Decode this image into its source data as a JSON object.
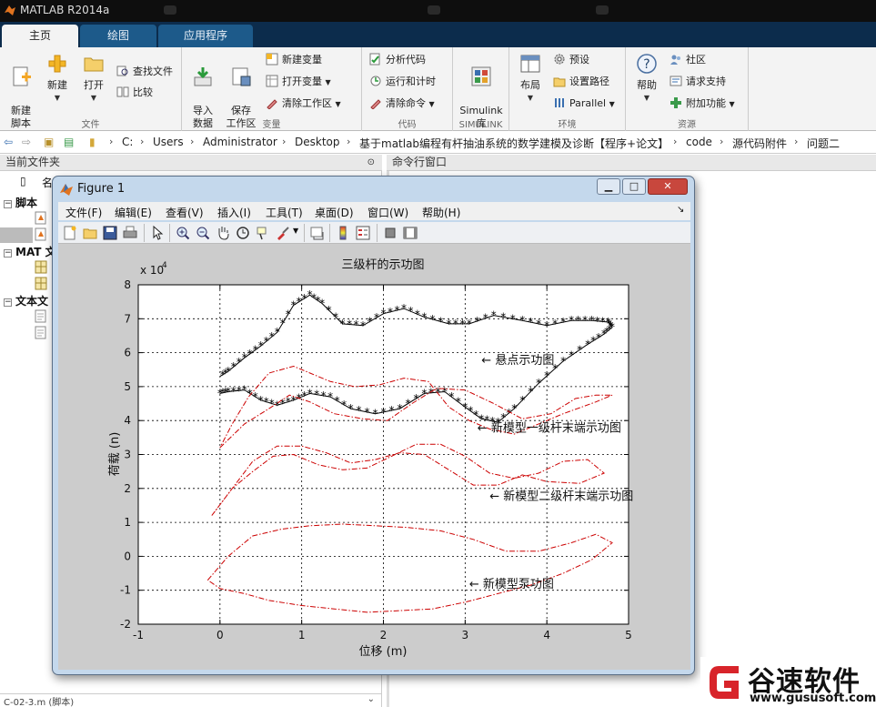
{
  "app": {
    "title": "MATLAB R2014a"
  },
  "tabs": [
    {
      "label": "主页",
      "active": true
    },
    {
      "label": "绘图",
      "active": false
    },
    {
      "label": "应用程序",
      "active": false
    }
  ],
  "ribbon": {
    "file": {
      "group": "文件",
      "new_script": "新建\n脚本",
      "new": "新建",
      "open": "打开",
      "find_files": "查找文件",
      "compare": "比较"
    },
    "variable": {
      "group": "变量",
      "import_data": "导入\n数据",
      "save_workspace": "保存\n工作区",
      "new_variable": "新建变量",
      "open_variable": "打开变量",
      "clear_workspace": "清除工作区"
    },
    "code": {
      "group": "代码",
      "analyze_code": "分析代码",
      "run_and_time": "运行和计时",
      "clear_commands": "清除命令"
    },
    "simulink": {
      "group": "SIMULINK",
      "library": "Simulink\n库"
    },
    "environment": {
      "group": "环境",
      "layout": "布局",
      "preferences": "预设",
      "set_path": "设置路径",
      "parallel": "Parallel"
    },
    "resources": {
      "group": "资源",
      "help": "帮助",
      "community": "社区",
      "request_support": "请求支持",
      "addons": "附加功能"
    }
  },
  "path": [
    "C:",
    "Users",
    "Administrator",
    "Desktop",
    "基于matlab编程有杆抽油系统的数学建模及诊断【程序+论文】",
    "code",
    "源代码附件",
    "问题二"
  ],
  "panels": {
    "current_folder": "当前文件夹",
    "command_window": "命令行窗口",
    "name_col": "名",
    "tree": [
      {
        "label": "脚本"
      },
      {
        "label": "MAT 文"
      },
      {
        "label": "文本文"
      }
    ],
    "status_file": "C-02-3.m (脚本)"
  },
  "figure": {
    "title": "Figure 1",
    "menu": [
      "文件(F)",
      "编辑(E)",
      "查看(V)",
      "插入(I)",
      "工具(T)",
      "桌面(D)",
      "窗口(W)",
      "帮助(H)"
    ]
  },
  "chart_data": {
    "type": "line",
    "title": "三级杆的示功图",
    "xlabel": "位移 (m)",
    "ylabel": "荷载 (n)",
    "y_scale_label": "x 10",
    "y_scale_exp": "4",
    "xlim": [
      -1,
      5
    ],
    "ylim": [
      -2,
      8
    ],
    "xticks": [
      -1,
      0,
      1,
      2,
      3,
      4,
      5
    ],
    "yticks": [
      -2,
      -1,
      0,
      1,
      2,
      3,
      4,
      5,
      6,
      7,
      8
    ],
    "grid": true,
    "series": [
      {
        "name": "悬点示功图",
        "color": "#000000",
        "style": "line-star",
        "points": [
          [
            0,
            4.8
          ],
          [
            0.1,
            4.85
          ],
          [
            0.3,
            4.9
          ],
          [
            0.5,
            4.6
          ],
          [
            0.7,
            4.45
          ],
          [
            0.9,
            4.6
          ],
          [
            1.1,
            4.8
          ],
          [
            1.35,
            4.7
          ],
          [
            1.6,
            4.35
          ],
          [
            1.9,
            4.2
          ],
          [
            2.2,
            4.35
          ],
          [
            2.5,
            4.8
          ],
          [
            2.75,
            4.85
          ],
          [
            3.0,
            4.4
          ],
          [
            3.2,
            4.05
          ],
          [
            3.4,
            3.95
          ],
          [
            3.6,
            4.35
          ],
          [
            3.9,
            5.1
          ],
          [
            4.2,
            5.75
          ],
          [
            4.5,
            6.25
          ],
          [
            4.7,
            6.55
          ],
          [
            4.8,
            6.75
          ],
          [
            4.75,
            6.9
          ],
          [
            4.55,
            6.95
          ],
          [
            4.3,
            6.95
          ],
          [
            4.0,
            6.8
          ],
          [
            3.7,
            6.95
          ],
          [
            3.35,
            7.1
          ],
          [
            3.05,
            6.85
          ],
          [
            2.8,
            6.85
          ],
          [
            2.5,
            7.05
          ],
          [
            2.25,
            7.3
          ],
          [
            2.0,
            7.15
          ],
          [
            1.75,
            6.8
          ],
          [
            1.5,
            6.85
          ],
          [
            1.25,
            7.45
          ],
          [
            1.1,
            7.7
          ],
          [
            0.9,
            7.4
          ],
          [
            0.7,
            6.6
          ],
          [
            0.5,
            6.2
          ],
          [
            0.3,
            5.85
          ],
          [
            0.1,
            5.45
          ],
          [
            0.0,
            5.3
          ]
        ]
      },
      {
        "name": "新模型一级杆末端示功图",
        "color": "#cc0000",
        "style": "dash-dot",
        "points": [
          [
            0,
            3.2
          ],
          [
            0.3,
            3.9
          ],
          [
            0.6,
            4.35
          ],
          [
            0.85,
            4.75
          ],
          [
            1.1,
            4.55
          ],
          [
            1.4,
            4.2
          ],
          [
            1.75,
            4.05
          ],
          [
            2.05,
            4.0
          ],
          [
            2.35,
            4.5
          ],
          [
            2.65,
            4.95
          ],
          [
            3.0,
            4.9
          ],
          [
            3.35,
            4.5
          ],
          [
            3.7,
            4.05
          ],
          [
            4.05,
            4.2
          ],
          [
            4.35,
            4.65
          ],
          [
            4.6,
            4.75
          ],
          [
            4.8,
            4.75
          ],
          [
            4.6,
            4.55
          ],
          [
            4.2,
            4.2
          ],
          [
            3.9,
            3.9
          ],
          [
            3.6,
            3.6
          ],
          [
            3.3,
            3.75
          ],
          [
            3.05,
            4.0
          ],
          [
            2.8,
            4.4
          ],
          [
            2.55,
            5.15
          ],
          [
            2.25,
            5.25
          ],
          [
            1.95,
            5.05
          ],
          [
            1.65,
            5.0
          ],
          [
            1.35,
            5.15
          ],
          [
            1.05,
            5.45
          ],
          [
            0.9,
            5.6
          ],
          [
            0.6,
            5.4
          ],
          [
            0.35,
            4.7
          ],
          [
            0.15,
            3.9
          ],
          [
            0,
            3.2
          ]
        ]
      },
      {
        "name": "新模型二级杆末端示功图",
        "color": "#cc0000",
        "style": "dash-dot",
        "points": [
          [
            -0.1,
            1.2
          ],
          [
            0.15,
            2.0
          ],
          [
            0.4,
            2.5
          ],
          [
            0.65,
            2.95
          ],
          [
            0.9,
            3.0
          ],
          [
            1.2,
            2.7
          ],
          [
            1.5,
            2.55
          ],
          [
            1.8,
            2.6
          ],
          [
            2.1,
            2.95
          ],
          [
            2.4,
            3.3
          ],
          [
            2.7,
            3.3
          ],
          [
            3.0,
            2.95
          ],
          [
            3.3,
            2.45
          ],
          [
            3.6,
            2.3
          ],
          [
            3.9,
            2.45
          ],
          [
            4.2,
            2.8
          ],
          [
            4.5,
            2.85
          ],
          [
            4.7,
            2.45
          ],
          [
            4.4,
            2.15
          ],
          [
            4.0,
            2.2
          ],
          [
            3.7,
            2.4
          ],
          [
            3.4,
            2.1
          ],
          [
            3.1,
            2.1
          ],
          [
            2.8,
            2.55
          ],
          [
            2.5,
            3.0
          ],
          [
            2.2,
            3.05
          ],
          [
            1.9,
            2.85
          ],
          [
            1.6,
            2.75
          ],
          [
            1.3,
            3.05
          ],
          [
            1.0,
            3.25
          ],
          [
            0.7,
            3.25
          ],
          [
            0.4,
            2.8
          ],
          [
            0.15,
            2.0
          ],
          [
            -0.1,
            1.2
          ]
        ]
      },
      {
        "name": "新模型泵功图",
        "color": "#cc0000",
        "style": "dash-dot",
        "points": [
          [
            -0.15,
            -0.7
          ],
          [
            0.1,
            0.0
          ],
          [
            0.4,
            0.6
          ],
          [
            0.75,
            0.8
          ],
          [
            1.1,
            0.9
          ],
          [
            1.5,
            0.95
          ],
          [
            1.9,
            0.9
          ],
          [
            2.3,
            0.85
          ],
          [
            2.7,
            0.75
          ],
          [
            3.1,
            0.5
          ],
          [
            3.5,
            0.15
          ],
          [
            3.9,
            0.15
          ],
          [
            4.3,
            0.4
          ],
          [
            4.6,
            0.65
          ],
          [
            4.8,
            0.4
          ],
          [
            4.55,
            -0.1
          ],
          [
            4.2,
            -0.5
          ],
          [
            3.8,
            -0.85
          ],
          [
            3.4,
            -1.1
          ],
          [
            3.0,
            -1.35
          ],
          [
            2.6,
            -1.55
          ],
          [
            2.2,
            -1.6
          ],
          [
            1.8,
            -1.65
          ],
          [
            1.4,
            -1.55
          ],
          [
            1.0,
            -1.45
          ],
          [
            0.6,
            -1.3
          ],
          [
            0.3,
            -1.1
          ],
          [
            0.0,
            -0.95
          ],
          [
            -0.15,
            -0.7
          ]
        ]
      }
    ],
    "annotations": [
      {
        "text": "← 悬点示功图",
        "x": 3.2,
        "y": 5.8
      },
      {
        "text": "← 新模型一级杆末端示功图",
        "x": 3.15,
        "y": 3.8
      },
      {
        "text": "← 新模型二级杆末端示功图",
        "x": 3.3,
        "y": 1.8
      },
      {
        "text": "← 新模型泵功图",
        "x": 3.05,
        "y": -0.8
      }
    ]
  },
  "watermark": {
    "brand": "谷速软件",
    "url": "www.gususoft.com"
  }
}
